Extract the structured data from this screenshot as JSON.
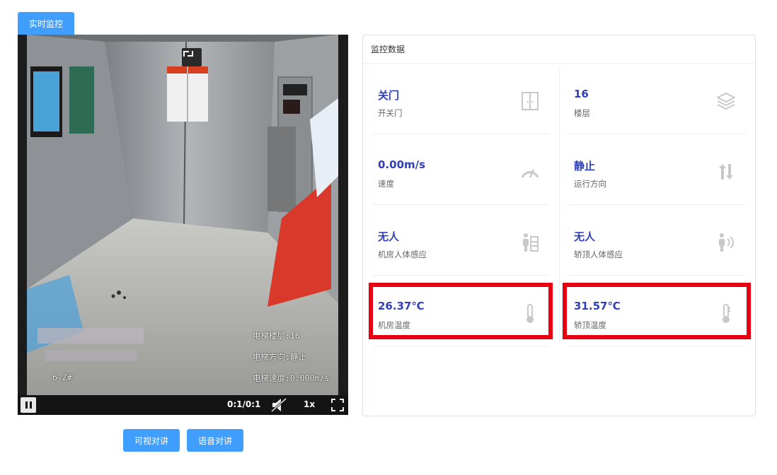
{
  "tab": {
    "label": "实时监控"
  },
  "video": {
    "osd_floor": "电梯楼层:16",
    "osd_direction": "电梯方向:静止",
    "osd_speed": "电梯速度:0.000m/s",
    "osd_camera": "6-Z#",
    "time": "0:1/0:1",
    "playback_speed": "1x"
  },
  "actions": {
    "video_talk": "可视对讲",
    "voice_talk": "语音对讲"
  },
  "panel": {
    "title": "监控数据",
    "items": [
      {
        "value": "关门",
        "label": "开关门",
        "icon": "door-icon"
      },
      {
        "value": "16",
        "label": "楼层",
        "icon": "layers-icon"
      },
      {
        "value": "0.00m/s",
        "label": "速度",
        "icon": "speedometer-icon"
      },
      {
        "value": "静止",
        "label": "运行方向",
        "icon": "up-down-arrows-icon"
      },
      {
        "value": "无人",
        "label": "机房人体感应",
        "icon": "person-sensor-icon"
      },
      {
        "value": "无人",
        "label": "轿顶人体感应",
        "icon": "person-signal-icon"
      },
      {
        "value": "26.37℃",
        "label": "机房温度",
        "icon": "thermometer-icon"
      },
      {
        "value": "31.57℃",
        "label": "轿顶温度",
        "icon": "thermometer-icon"
      }
    ]
  },
  "colors": {
    "primary": "#409eff",
    "value_text": "#2f3fb8",
    "highlight": "#e60012"
  }
}
